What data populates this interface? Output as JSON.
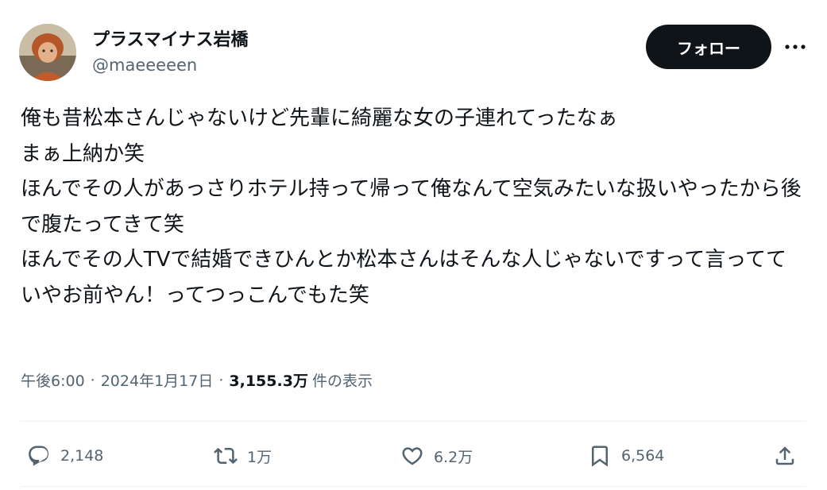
{
  "user": {
    "display_name": "プラスマイナス岩橋",
    "handle": "@maeeeeen"
  },
  "buttons": {
    "follow_label": "フォロー"
  },
  "tweet": {
    "text": "俺も昔松本さんじゃないけど先輩に綺麗な女の子連れてったなぁ\nまぁ上納か笑\nほんでその人があっさりホテル持って帰って俺なんて空気みたいな扱いやったから後で腹たってきて笑\nほんでその人TVで結婚できひんとか松本さんはそんな人じゃないですって言ってて\nいやお前やん！ってつっこんでもた笑"
  },
  "meta": {
    "time": "午後6:00",
    "separator": "·",
    "date": "2024年1月17日",
    "views_count": "3,155.3万",
    "views_label": "件の表示"
  },
  "actions": {
    "replies": "2,148",
    "reposts": "1万",
    "likes": "6.2万",
    "bookmarks": "6,564"
  },
  "icons": {
    "more": "more-horizontal-icon",
    "reply": "reply-icon",
    "repost": "repost-icon",
    "like": "heart-icon",
    "bookmark": "bookmark-icon",
    "share": "share-icon"
  },
  "colors": {
    "text_primary": "#0f1419",
    "text_secondary": "#536471",
    "button_bg": "#0f1419",
    "divider": "#eff3f4"
  }
}
